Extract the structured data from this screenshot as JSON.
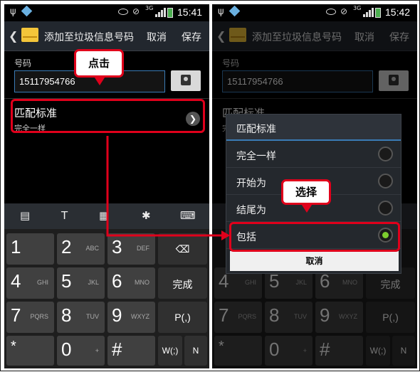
{
  "status_bar_left": {
    "time": "15:41",
    "network": "3G"
  },
  "status_bar_right": {
    "time": "15:42",
    "network": "3G"
  },
  "titlebar": {
    "title": "添加至垃圾信息号码",
    "cancel_label": "取消",
    "save_label": "保存"
  },
  "form": {
    "number_label": "号码",
    "number_value": "15117954766",
    "match_title": "匹配标准",
    "match_value": "完全一样"
  },
  "keyboard": {
    "keys": [
      {
        "digit": "1",
        "letters": ""
      },
      {
        "digit": "2",
        "letters": "ABC"
      },
      {
        "digit": "3",
        "letters": "DEF"
      },
      {
        "digit": "4",
        "letters": "GHI"
      },
      {
        "digit": "5",
        "letters": "JKL"
      },
      {
        "digit": "6",
        "letters": "MNO"
      },
      {
        "digit": "7",
        "letters": "PQRS"
      },
      {
        "digit": "8",
        "letters": "TUV"
      },
      {
        "digit": "9",
        "letters": "WXYZ"
      },
      {
        "digit": "*",
        "letters": ""
      },
      {
        "digit": "0",
        "letters": "+"
      },
      {
        "digit": "#",
        "letters": ""
      }
    ],
    "done_label": "完成",
    "p_label": "P(,)",
    "w_label": "W(;)",
    "n_label": "N"
  },
  "dialog": {
    "title": "匹配标准",
    "options": [
      {
        "label": "完全一样",
        "selected": false
      },
      {
        "label": "开始为",
        "selected": false
      },
      {
        "label": "结尾为",
        "selected": false
      },
      {
        "label": "包括",
        "selected": true
      }
    ],
    "cancel_label": "取消"
  },
  "callouts": {
    "click": "点击",
    "select": "选择"
  },
  "colors": {
    "highlight": "#e0001b",
    "accent": "#3a7bb5",
    "selected_radio": "#7ccd2e"
  }
}
